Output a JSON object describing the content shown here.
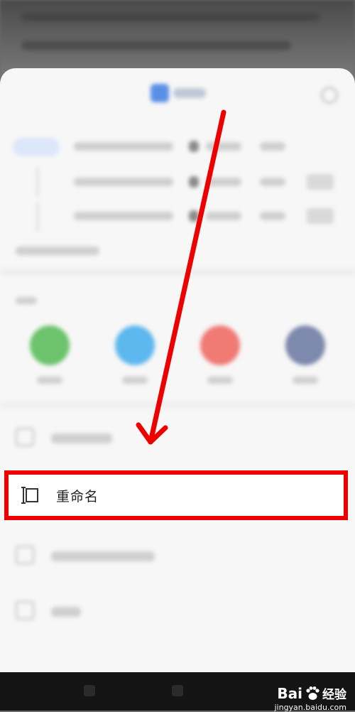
{
  "menu": {
    "rename_label": "重命名"
  },
  "watermark": {
    "brand_left": "Bai",
    "brand_right": "经验",
    "url": "jingyan.baidu.com"
  },
  "icons": {
    "rename": "rename-icon",
    "arrow": "red-arrow-annotation",
    "paw": "baidu-paw-icon"
  },
  "colors": {
    "annotation_red": "#ee0000",
    "sheet_bg": "#f7f7f7",
    "share_green": "#6cc36c",
    "share_blue": "#5cb8ee",
    "share_red": "#f07a74",
    "share_slate": "#7d89ad"
  }
}
